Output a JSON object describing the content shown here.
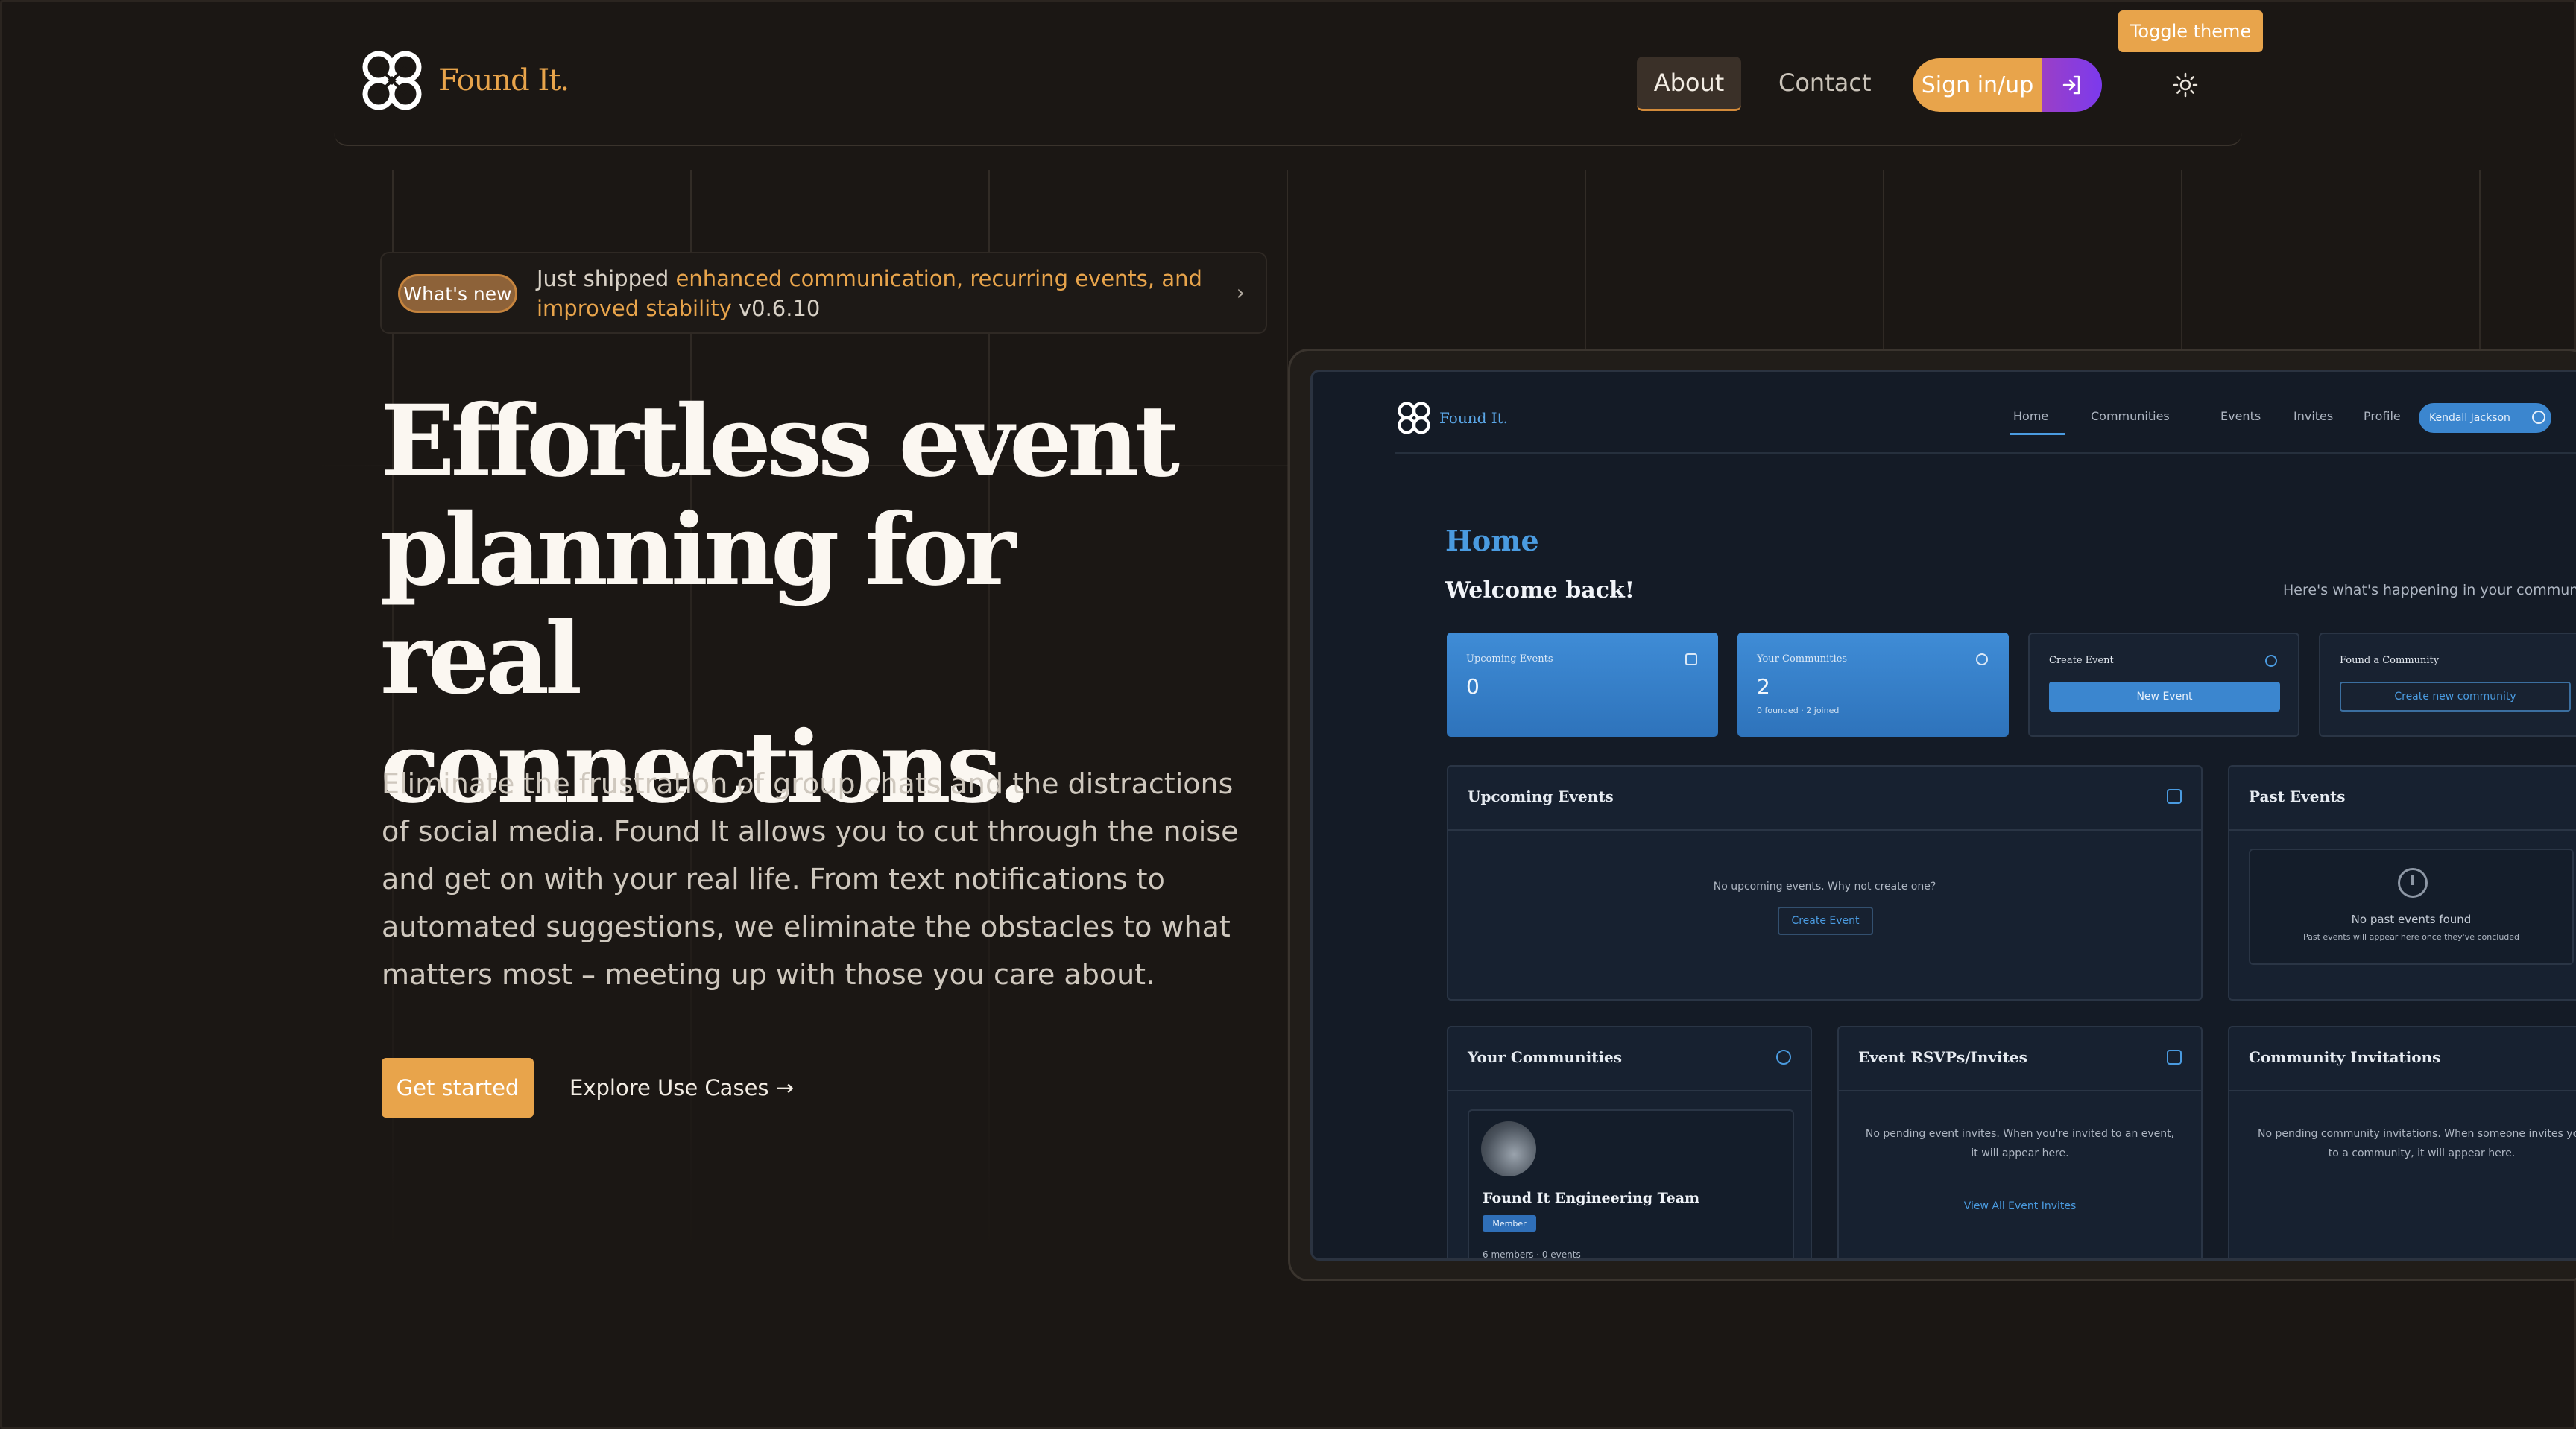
{
  "tooltip": {
    "text": "Toggle theme"
  },
  "header": {
    "brand": "Found It.",
    "nav": {
      "about": "About",
      "contact": "Contact"
    },
    "signin_label": "Sign in/up"
  },
  "announcement": {
    "badge": "What's new",
    "prefix": "Just shipped ",
    "highlight": "enhanced communication, recurring events, and improved stability",
    "version": " v0.6.10"
  },
  "hero": {
    "title": "Effortless event planning for real connections.",
    "description": "Eliminate the frustration of group chats and the distractions of social media. Found It allows you to cut through the noise and get on with your real life. From text notifications to automated suggestions, we eliminate the obstacles to what matters most – meeting up with those you care about.",
    "cta_primary": "Get started",
    "cta_secondary": "Explore Use Cases →"
  },
  "preview": {
    "brand": "Found It.",
    "nav": [
      "Home",
      "Communities",
      "Events",
      "Invites",
      "Profile"
    ],
    "user": "Kendall Jackson",
    "page_title": "Home",
    "welcome": "Welcome back!",
    "subtitle": "Here's what's happening in your communities",
    "stats": {
      "upcoming": {
        "label": "Upcoming Events",
        "value": "0"
      },
      "communities": {
        "label": "Your Communities",
        "value": "2",
        "meta": "0 founded · 2 joined"
      },
      "create": {
        "label": "Create Event",
        "button": "New Event"
      },
      "found": {
        "label": "Found a Community",
        "button": "Create new community"
      }
    },
    "upcoming_card": {
      "title": "Upcoming Events",
      "message": "No upcoming events. Why not create one?",
      "button": "Create Event"
    },
    "past_card": {
      "title": "Past Events",
      "message": "No past events found",
      "sub": "Past events will appear here once they've concluded"
    },
    "communities_card": {
      "title": "Your Communities",
      "community_name": "Found It Engineering Team",
      "role": "Member",
      "meta": "6 members · 0 events"
    },
    "rsvp_card": {
      "title": "Event RSVPs/Invites",
      "message": "No pending event invites. When you're invited to an event, it will appear here.",
      "link": "View All Event Invites"
    },
    "invites_card": {
      "title": "Community Invitations",
      "message": "No pending community invitations. When someone invites you to a community, it will appear here."
    }
  },
  "colors": {
    "accent": "#e8a44b",
    "background": "#1b1714",
    "preview_accent": "#4a9be0"
  }
}
